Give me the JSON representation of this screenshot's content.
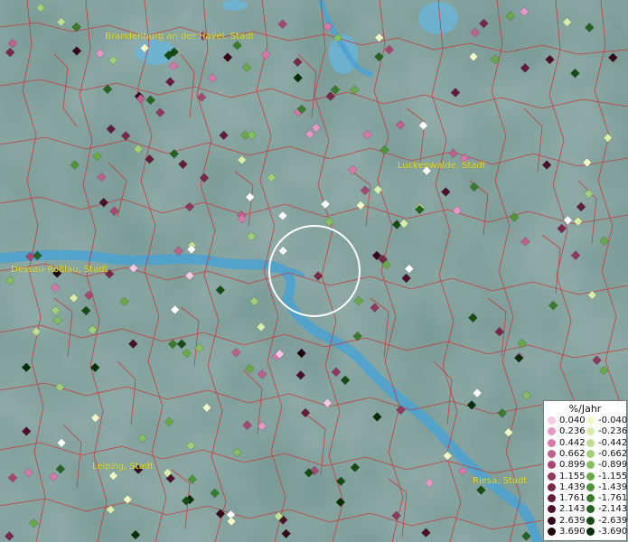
{
  "map": {
    "city_labels": [
      {
        "name": "Brandenburg an der Havel, Stadt"
      },
      {
        "name": "Luckenwalde, Stadt"
      },
      {
        "name": "Dessau-Roßlau, Stadt"
      },
      {
        "name": "Leipzig, Stadt"
      },
      {
        "name": "Riesa, Stadt"
      }
    ],
    "colors": {
      "background": "#7a9a96",
      "boundaries": "#d22a2a",
      "river": "#4a9ed0",
      "label": "#e8e030",
      "selection_ring": "#ffffff"
    }
  },
  "legend": {
    "title": "%/Jahr",
    "positive": [
      {
        "label": "0.040",
        "color": "#f6c8e6"
      },
      {
        "label": "0.236",
        "color": "#e898c8"
      },
      {
        "label": "0.442",
        "color": "#d878aa"
      },
      {
        "label": "0.662",
        "color": "#c0608c"
      },
      {
        "label": "0.899",
        "color": "#a84872"
      },
      {
        "label": "1.155",
        "color": "#903860"
      },
      {
        "label": "1.439",
        "color": "#7a2848"
      },
      {
        "label": "1.761",
        "color": "#641c38"
      },
      {
        "label": "2.143",
        "color": "#4e1028"
      },
      {
        "label": "2.639",
        "color": "#380818"
      },
      {
        "label": "3.690",
        "color": "#200008"
      }
    ],
    "negative": [
      {
        "label": "-0.040",
        "color": "#f0f8c8"
      },
      {
        "label": "-0.236",
        "color": "#d8eeaa"
      },
      {
        "label": "-0.442",
        "color": "#bee090"
      },
      {
        "label": "-0.662",
        "color": "#a0d078"
      },
      {
        "label": "-0.899",
        "color": "#84c060"
      },
      {
        "label": "-1.155",
        "color": "#68aa48"
      },
      {
        "label": "-1.439",
        "color": "#4e9438"
      },
      {
        "label": "-1.761",
        "color": "#387c2c"
      },
      {
        "label": "-2.143",
        "color": "#246420"
      },
      {
        "label": "-2.639",
        "color": "#144c14"
      },
      {
        "label": "-3.690",
        "color": "#063008"
      }
    ]
  }
}
